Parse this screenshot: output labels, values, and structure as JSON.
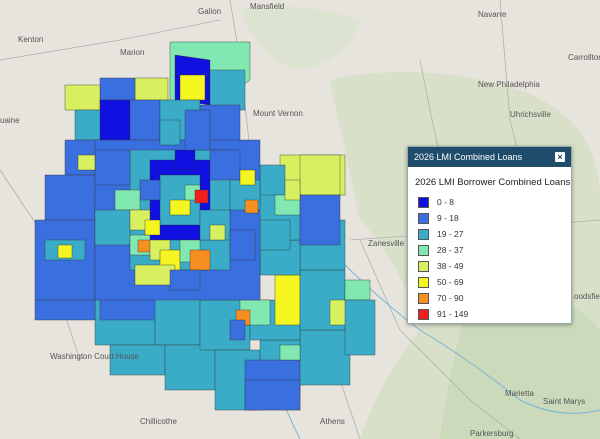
{
  "places": [
    {
      "id": "galion",
      "label": "Galion"
    },
    {
      "id": "mansfield",
      "label": "Mansfield"
    },
    {
      "id": "kenton",
      "label": "Kenton"
    },
    {
      "id": "marion",
      "label": "Marion"
    },
    {
      "id": "navarre",
      "label": "Navarre"
    },
    {
      "id": "carrollton",
      "label": "Carrollton"
    },
    {
      "id": "new-philadelphia",
      "label": "New Philadelphia"
    },
    {
      "id": "mount-vernon",
      "label": "Mount Vernon"
    },
    {
      "id": "uhrichsville",
      "label": "Uhrichsville"
    },
    {
      "id": "zanesville",
      "label": "Zanesville"
    },
    {
      "id": "washington-court-house",
      "label": "Washington\nCourt House"
    },
    {
      "id": "chillicothe",
      "label": "Chillicothe"
    },
    {
      "id": "athens",
      "label": "Athens"
    },
    {
      "id": "marietta",
      "label": "Marietta"
    },
    {
      "id": "saint-marys",
      "label": "Saint Marys"
    },
    {
      "id": "parkersburg",
      "label": "Parkersburg"
    },
    {
      "id": "woodsfield",
      "label": "oodsfield"
    },
    {
      "id": "uaine",
      "label": "uaine"
    }
  ],
  "legend": {
    "title": "2026 LMI Combined Loans",
    "close_label": "×",
    "subtitle": "2026 LMI Borrower Combined Loans",
    "classes": [
      {
        "label": "0 - 8",
        "color": "#1010e0"
      },
      {
        "label": "9 - 18",
        "color": "#3a6fe0"
      },
      {
        "label": "19 - 27",
        "color": "#3aacc8"
      },
      {
        "label": "28 - 37",
        "color": "#80e8b0"
      },
      {
        "label": "38 - 49",
        "color": "#d8f060"
      },
      {
        "label": "50 - 69",
        "color": "#f5f520"
      },
      {
        "label": "70 - 90",
        "color": "#f59020"
      },
      {
        "label": "91 - 149",
        "color": "#f02020"
      }
    ]
  }
}
